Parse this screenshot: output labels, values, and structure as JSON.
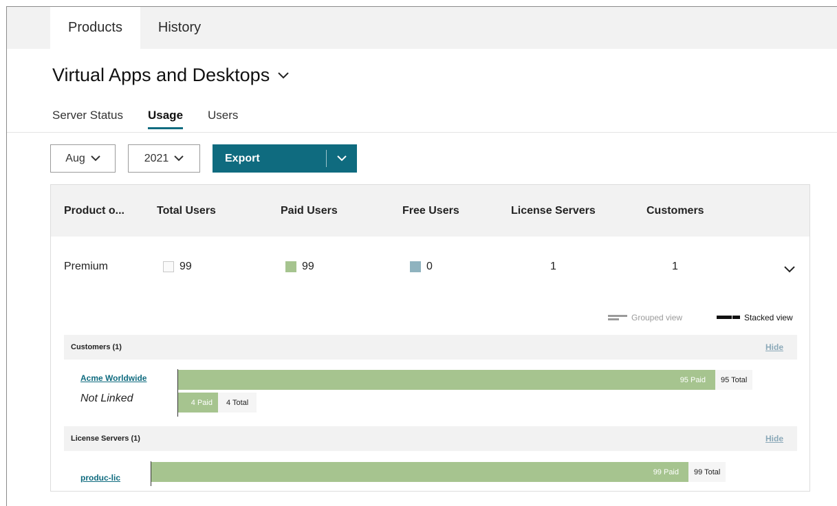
{
  "top_tabs": [
    {
      "label": "Products",
      "active": true
    },
    {
      "label": "History",
      "active": false
    }
  ],
  "product_title": "Virtual Apps and Desktops",
  "sub_tabs": [
    {
      "label": "Server Status",
      "active": false
    },
    {
      "label": "Usage",
      "active": true
    },
    {
      "label": "Users",
      "active": false
    }
  ],
  "controls": {
    "month": "Aug",
    "year": "2021",
    "export_label": "Export"
  },
  "table": {
    "headers": [
      "Product o...",
      "Total Users",
      "Paid Users",
      "Free Users",
      "License Servers",
      "Customers"
    ],
    "row": {
      "product": "Premium",
      "total_users": "99",
      "paid_users": "99",
      "free_users": "0",
      "license_servers": "1",
      "customers": "1"
    }
  },
  "view_toggle": {
    "grouped": "Grouped view",
    "stacked": "Stacked view",
    "active": "stacked"
  },
  "customers_section": {
    "title": "Customers (1)",
    "hide_label": "Hide",
    "rows": [
      {
        "name": "Acme Worldwide",
        "linked": true,
        "paid": 95,
        "paid_label": "95 Paid",
        "total_label": "95 Total"
      },
      {
        "name": "Not Linked",
        "linked": false,
        "paid": 4,
        "paid_label": "4 Paid",
        "total_label": "4 Total"
      }
    ]
  },
  "license_servers_section": {
    "title": "License Servers (1)",
    "hide_label": "Hide",
    "rows": [
      {
        "name": "produc-lic",
        "paid": 99,
        "paid_label": "99 Paid",
        "total_label": "99 Total"
      }
    ]
  },
  "colors": {
    "accent": "#0f6b7f",
    "paid": "#a6c48f",
    "free": "#8fb3bf",
    "total": "#f5f5f5"
  }
}
